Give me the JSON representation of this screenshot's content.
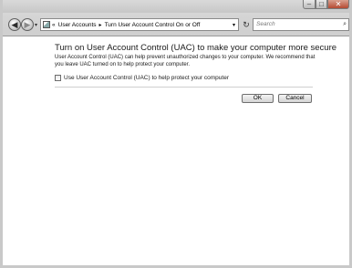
{
  "window": {
    "caption_min": "–",
    "caption_max": "□",
    "caption_close": "✕"
  },
  "nav": {
    "back_glyph": "◀",
    "forward_glyph": "▶",
    "drop_glyph": "▾",
    "breadcrumb_overflow": "«",
    "breadcrumbs": [
      "User Accounts",
      "Turn User Account Control On or Off"
    ],
    "breadcrumb_sep": "▸",
    "address_drop_glyph": "▾",
    "refresh_glyph": "↻",
    "search_placeholder": "Search",
    "search_glyph": "⌕"
  },
  "main": {
    "heading": "Turn on User Account Control (UAC) to make your computer more secure",
    "description": "User Account Control (UAC) can help prevent unauthorized changes to your computer.  We recommend that you leave UAC turned on to help protect your computer.",
    "checkbox_label": "Use User Account Control (UAC) to help protect your computer",
    "checkbox_checked": false,
    "ok_label": "OK",
    "cancel_label": "Cancel"
  }
}
